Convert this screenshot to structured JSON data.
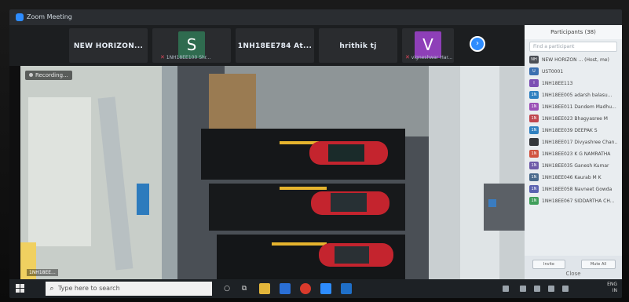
{
  "window": {
    "title": "Zoom Meeting"
  },
  "gallery": [
    {
      "name": "NEW HORIZON...",
      "sub": ""
    },
    {
      "avatar": "S",
      "avatar_color": "#2f6b4f",
      "sub": "1NH18EE100 Shr..."
    },
    {
      "name": "1NH18EE784 At...",
      "sub": ""
    },
    {
      "name": "hrithik tj",
      "sub": ""
    },
    {
      "avatar": "V",
      "avatar_color": "#8e3fb8",
      "sub": "vigneshwar Har..."
    }
  ],
  "main_video": {
    "recording_label": "Recording...",
    "name_label": "1NH18EE..."
  },
  "participants": {
    "header": "Participants (38)",
    "search_placeholder": "Find a participant",
    "items": [
      {
        "initials": "NH",
        "color": "#4b4f55",
        "name": "NEW HORIZON ... (Host, me)"
      },
      {
        "initials": "U",
        "color": "#3a6fb0",
        "name": "UST0001"
      },
      {
        "initials": "I",
        "color": "#7b4fb3",
        "name": "1NH18EE113"
      },
      {
        "initials": "1N",
        "color": "#2f80c0",
        "name": "1NH18EE005 adarsh balasu..."
      },
      {
        "initials": "1N",
        "color": "#9b4fb6",
        "name": "1NH18EE011 Dandem Madhu..."
      },
      {
        "initials": "1N",
        "color": "#c0464e",
        "name": "1NH18EE023 Bhagyasree M"
      },
      {
        "initials": "1N",
        "color": "#2f80c0",
        "name": "1NH18EE039 DEEPAK S"
      },
      {
        "initials": "",
        "color": "#34373b",
        "name": "1NH18EE017 Divyashree Chan..."
      },
      {
        "initials": "1N",
        "color": "#d0533f",
        "name": "1NH18EE023 K G NAMRATHA"
      },
      {
        "initials": "1N",
        "color": "#6e5aa8",
        "name": "1NH18EE035 Ganesh Kumar"
      },
      {
        "initials": "1N",
        "color": "#4a6a8c",
        "name": "1NH18EE046 Kaurab M K"
      },
      {
        "initials": "1N",
        "color": "#5a62b0",
        "name": "1NH18EE058 Navneet Gowda"
      },
      {
        "initials": "1N",
        "color": "#3f9e5a",
        "name": "1NH18EE067 SIDDARTHA CH..."
      }
    ],
    "btn_invite": "Invite",
    "btn_mute_all": "Mute All",
    "close": "Close"
  },
  "taskbar": {
    "search_placeholder": "Type here to search",
    "tray_lang": "ENG",
    "tray_region": "IN"
  }
}
